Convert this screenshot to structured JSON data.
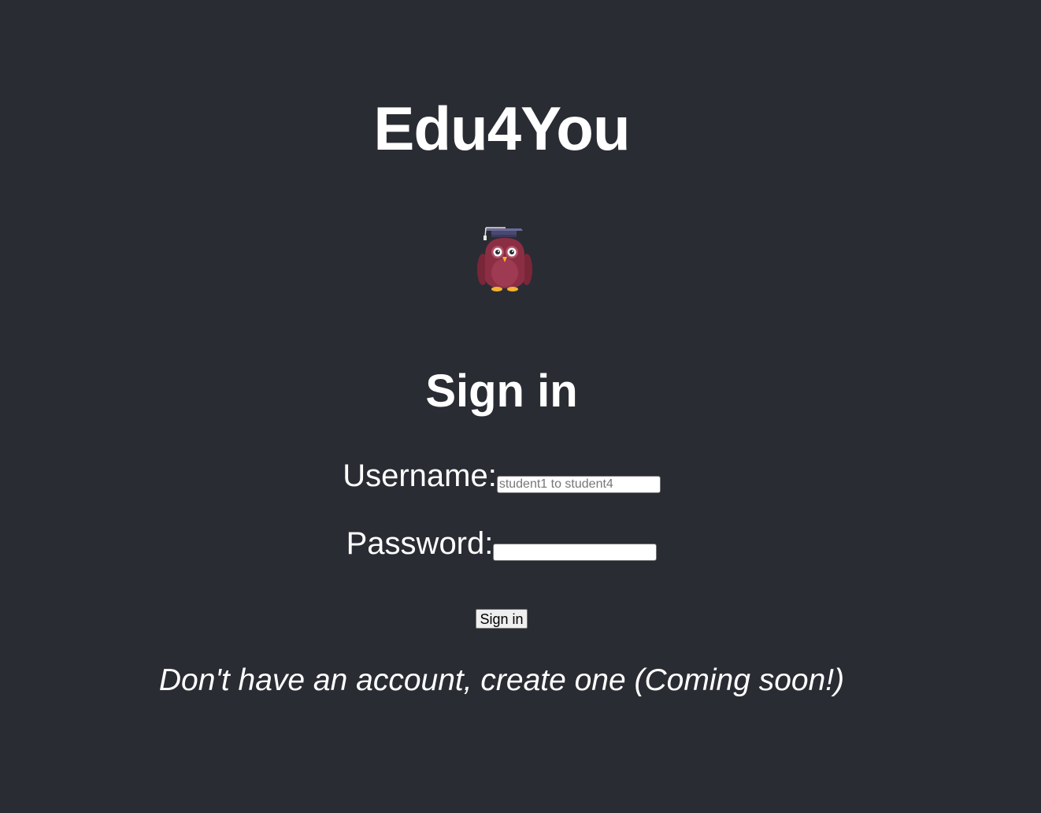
{
  "app": {
    "title": "Edu4You",
    "logo_icon": "owl-graduate-icon"
  },
  "signin": {
    "heading": "Sign in",
    "username_label": "Username:",
    "username_value": "",
    "username_placeholder": "student1 to student4",
    "password_label": "Password:",
    "password_value": "",
    "password_placeholder": "",
    "submit_label": "Sign in",
    "create_account_note": "Don't have an account, create one (Coming soon!)"
  },
  "colors": {
    "background": "#2a2c33",
    "text": "#ffffff",
    "owl_body": "#8b2e44",
    "owl_cap": "#4a4870",
    "owl_feet": "#f2b233"
  }
}
